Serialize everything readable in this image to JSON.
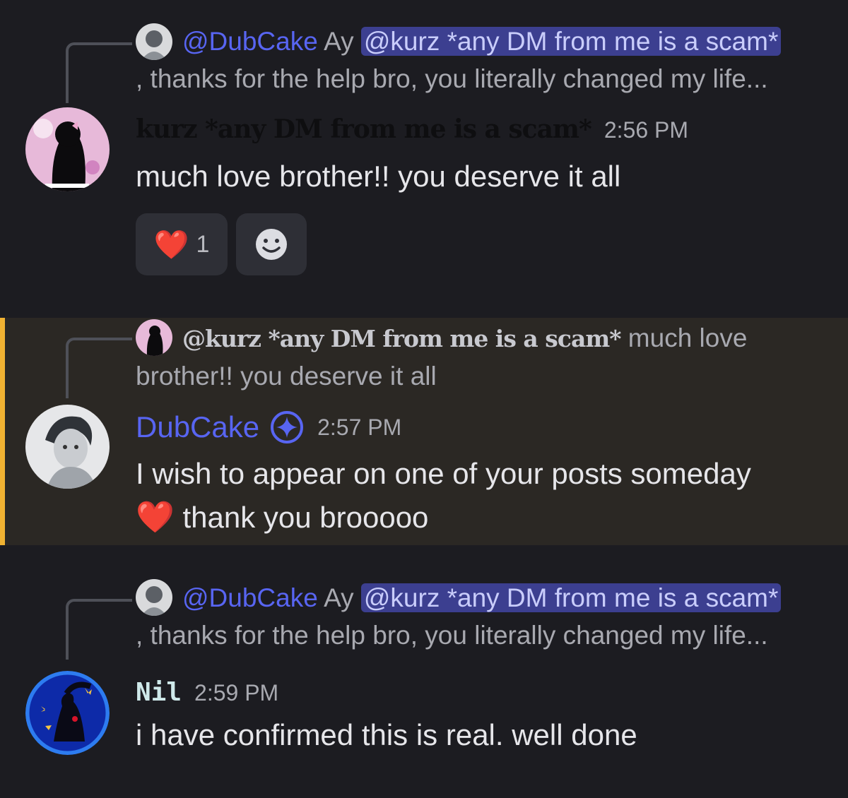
{
  "messages": [
    {
      "reply": {
        "author": "@DubCake",
        "text_lead": "Ay",
        "mention": "@kurz *any DM from me is a scam*",
        "text_tail": ", thanks for the help bro, you literally changed my life..."
      },
      "author": "kurz *any DM from me is a scam*",
      "time": "2:56 PM",
      "content": "much love brother!! you deserve it all",
      "reactions": [
        {
          "emoji": "❤️",
          "count": "1"
        },
        {
          "icon": "add-reaction-icon"
        }
      ]
    },
    {
      "reply": {
        "author": "@kurz *any DM from me is a scam*",
        "text": "much love brother!! you deserve it all"
      },
      "author": "DubCake",
      "badge_icon": "nitro-star-icon",
      "time": "2:57 PM",
      "content_line1": "I wish to appear on one of your posts someday",
      "content_emoji": "❤️",
      "content_line2": "thank you brooooo"
    },
    {
      "reply": {
        "author": "@DubCake",
        "text_lead": "Ay",
        "mention": "@kurz *any DM from me is a scam*",
        "text_tail": ", thanks for the help bro, you literally changed my life..."
      },
      "author": "Nil",
      "time": "2:59 PM",
      "content": "i have confirmed this is real. well done"
    }
  ],
  "colors": {
    "background": "#1c1c21",
    "highlight": "#2b2824",
    "highlight_bar": "#f0b232",
    "mention": "#5865f2"
  }
}
